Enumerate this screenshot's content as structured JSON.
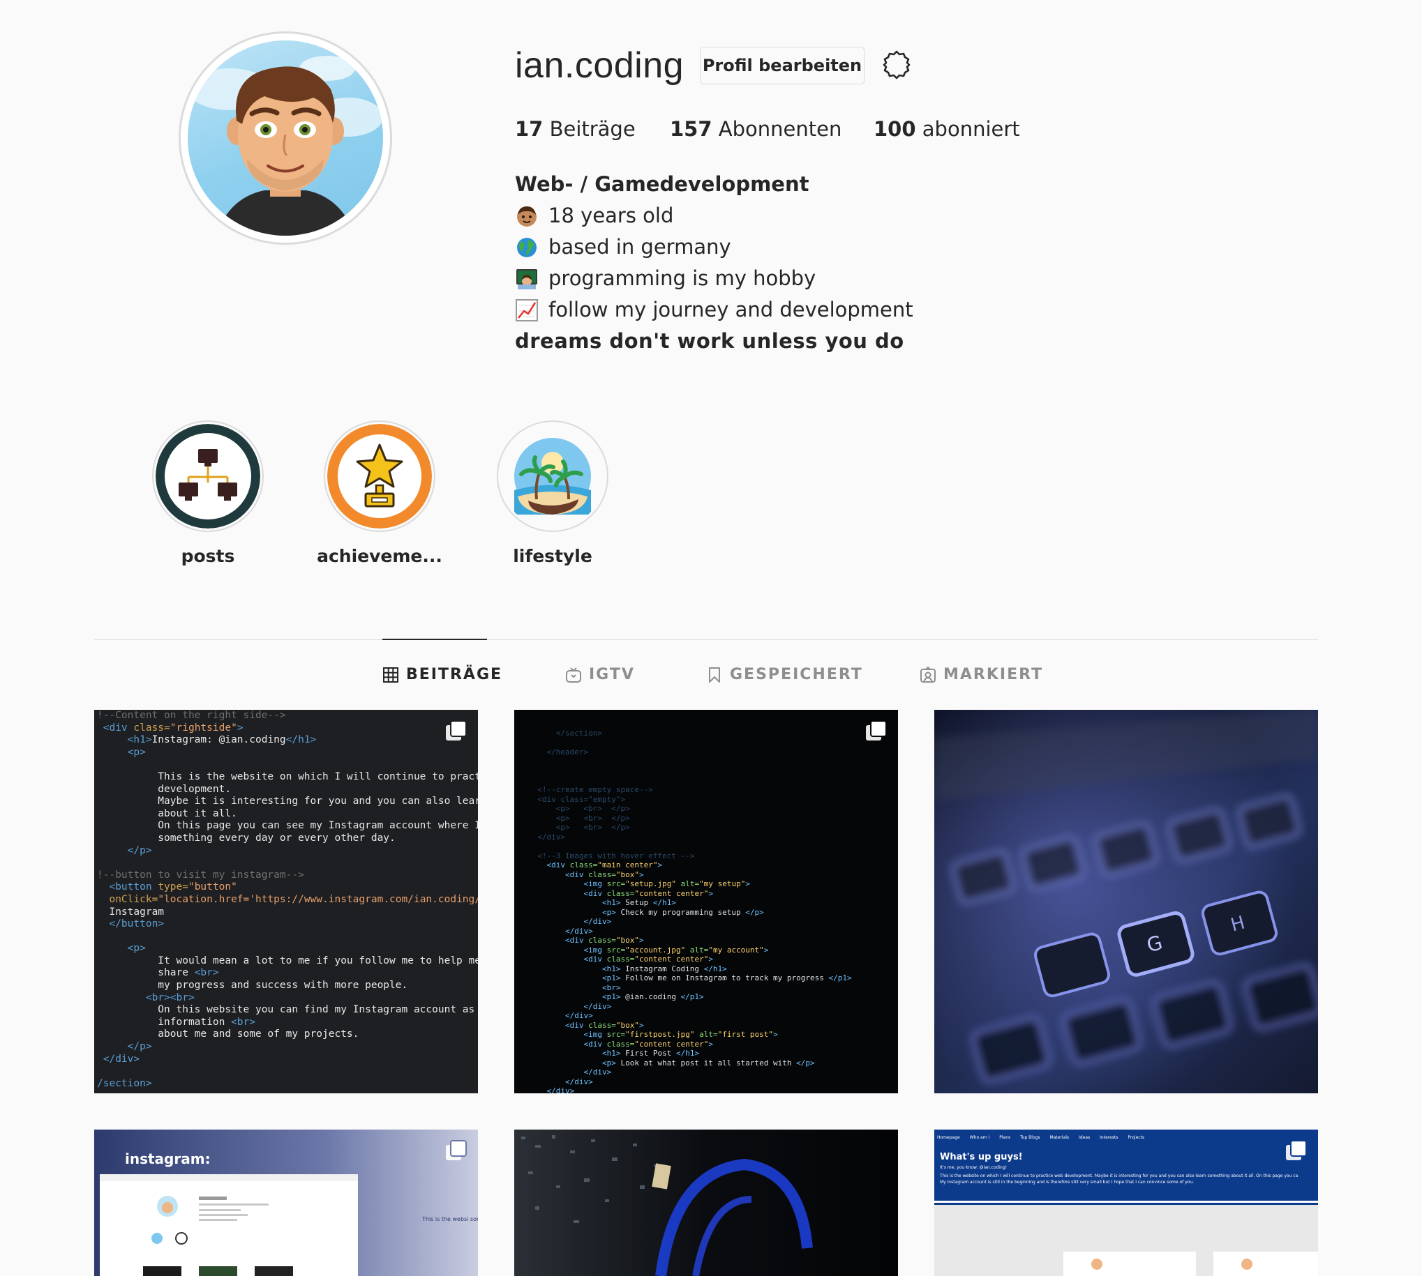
{
  "profile": {
    "username": "ian.coding",
    "edit_label": "Profil bearbeiten",
    "settings_icon": "gear-icon",
    "stats": {
      "posts_count": "17",
      "posts_label": "Beiträge",
      "followers_count": "157",
      "followers_label": "Abonnenten",
      "following_count": "100",
      "following_label": "abonniert"
    },
    "bio": {
      "name": "Web- / Gamedevelopment",
      "lines": [
        {
          "icon": "boy-face-emoji",
          "text": "18 years old"
        },
        {
          "icon": "globe-emoji",
          "text": "based in germany"
        },
        {
          "icon": "computer-programmer-emoji",
          "text": "programming is my hobby"
        },
        {
          "icon": "chart-increasing-emoji",
          "text": "follow my journey and development"
        }
      ],
      "quote": "dreams don't work unless you do"
    }
  },
  "highlights": [
    {
      "label": "posts",
      "icon": "network-computers-icon"
    },
    {
      "label": "achieveme...",
      "icon": "trophy-star-icon"
    },
    {
      "label": "lifestyle",
      "icon": "beach-island-icon"
    }
  ],
  "tabs": [
    {
      "label": "BEITRÄGE",
      "icon": "grid-icon",
      "active": true
    },
    {
      "label": "IGTV",
      "icon": "igtv-icon",
      "active": false
    },
    {
      "label": "GESPEICHERT",
      "icon": "bookmark-icon",
      "active": false
    },
    {
      "label": "MARKIERT",
      "icon": "tagged-person-icon",
      "active": false
    }
  ],
  "posts": [
    {
      "kind": "code-screenshot",
      "multiple": true
    },
    {
      "kind": "code-screenshot",
      "multiple": true
    },
    {
      "kind": "keyboard-photo",
      "multiple": false
    },
    {
      "kind": "instagram-website-screenshot",
      "multiple": true,
      "caption": "instagram:",
      "side_text": "This is the websi something abou"
    },
    {
      "kind": "dark-desk-photo",
      "multiple": false
    },
    {
      "kind": "website-screenshot",
      "multiple": true,
      "nav": [
        "Homepage",
        "Who am I",
        "Plans",
        "Top Blogs",
        "Materials",
        "Ideas",
        "Interests",
        "Projects"
      ],
      "heading": "What's up guys!",
      "sub": "It's me, you know: @ian.coding!",
      "body1": "This is the website on which I will continue to practice web development. Maybe it is interesting for you and you can also learn something about it all. On this page you ca",
      "body2": "My instagram account is still in the beginning and is therefore still very small but I hope that I can convince some of you."
    }
  ],
  "colors": {
    "background": "#fafafa",
    "text": "#262626",
    "muted": "#8e8e8e",
    "border": "#dbdbdb",
    "site_blue": "#0d3b8c"
  }
}
